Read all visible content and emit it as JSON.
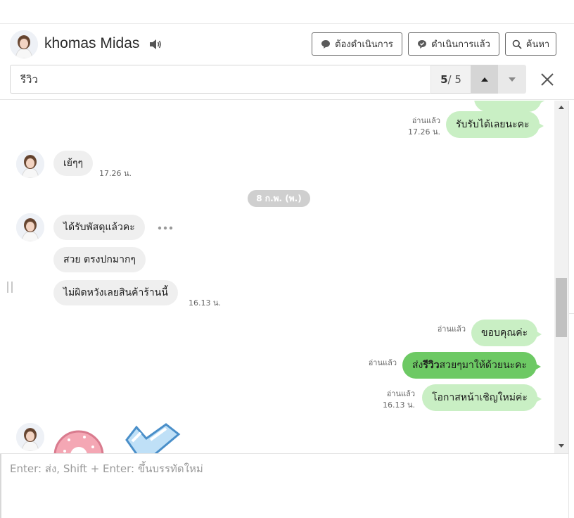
{
  "header": {
    "contact_name": "khomas Midas",
    "buttons": {
      "todo_label": "ต้องดำเนินการ",
      "done_label": "ดำเนินการแล้ว",
      "search_label": "ค้นหา"
    }
  },
  "search": {
    "query": "รีวิว",
    "current": "5",
    "total": "/ 5"
  },
  "messages": {
    "out_1": {
      "read": "อ่านแล้ว",
      "time": "17.26 น.",
      "text": "รับรับได้เลยนะคะ"
    },
    "in_1": {
      "text": "เย้ๆๆ",
      "time": "17.26 น."
    },
    "date_divider": "8 ก.พ. (พ.)",
    "in_2": {
      "text": "ได้รับพัสดุแล้วคะ"
    },
    "in_3": {
      "text": "สวย ตรงปกมากๆ"
    },
    "in_4": {
      "text": "ไม่ผิดหวังเลยสินค้าร้านนี้",
      "time": "16.13 น."
    },
    "out_2": {
      "read": "อ่านแล้ว",
      "text": "ขอบคุณค่ะ"
    },
    "out_3": {
      "read": "อ่านแล้ว",
      "text_before": "ส่ง",
      "text_highlight": "รีวิว",
      "text_after": "สวยๆมาให้ด้วยนะคะ"
    },
    "out_4": {
      "read": "อ่านแล้ว",
      "time": "16.13 น.",
      "text": "โอกาสหน้าเชิญใหม่ค่ะ"
    }
  },
  "composer": {
    "placeholder": "Enter: ส่ง, Shift + Enter: ขึ้นบรรทัดใหม่"
  },
  "colors": {
    "bubble_out": "#c9efc4",
    "bubble_out_highlight": "#6dc964",
    "bubble_in": "#efefef"
  },
  "icons": {
    "speaker": "speaker-icon",
    "todo": "chat-bubble-icon",
    "done": "check-chat-icon",
    "search": "search-icon",
    "up": "caret-up-icon",
    "down": "caret-down-icon",
    "close": "close-icon",
    "more": "more-horizontal-icon"
  }
}
